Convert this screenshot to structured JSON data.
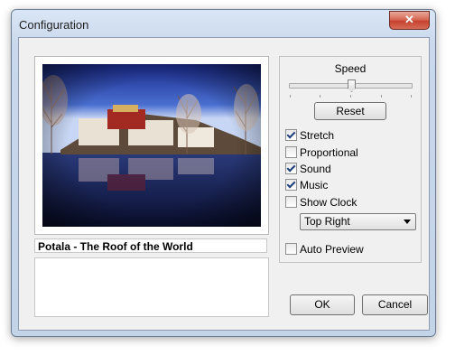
{
  "window": {
    "title": "Configuration",
    "close_glyph": "✕"
  },
  "image": {
    "icon": "photo-preview",
    "caption": "Potala - The Roof of the World"
  },
  "options": {
    "speed_label": "Speed",
    "speed_value": 0.5,
    "reset_label": "Reset",
    "checkboxes": [
      {
        "label": "Stretch",
        "checked": true
      },
      {
        "label": "Proportional",
        "checked": false
      },
      {
        "label": "Sound",
        "checked": true
      },
      {
        "label": "Music",
        "checked": true
      },
      {
        "label": "Show Clock",
        "checked": false
      }
    ],
    "clock_position": "Top Right",
    "auto_preview_label": "Auto Preview",
    "auto_preview_checked": false
  },
  "buttons": {
    "ok": "OK",
    "cancel": "Cancel"
  }
}
